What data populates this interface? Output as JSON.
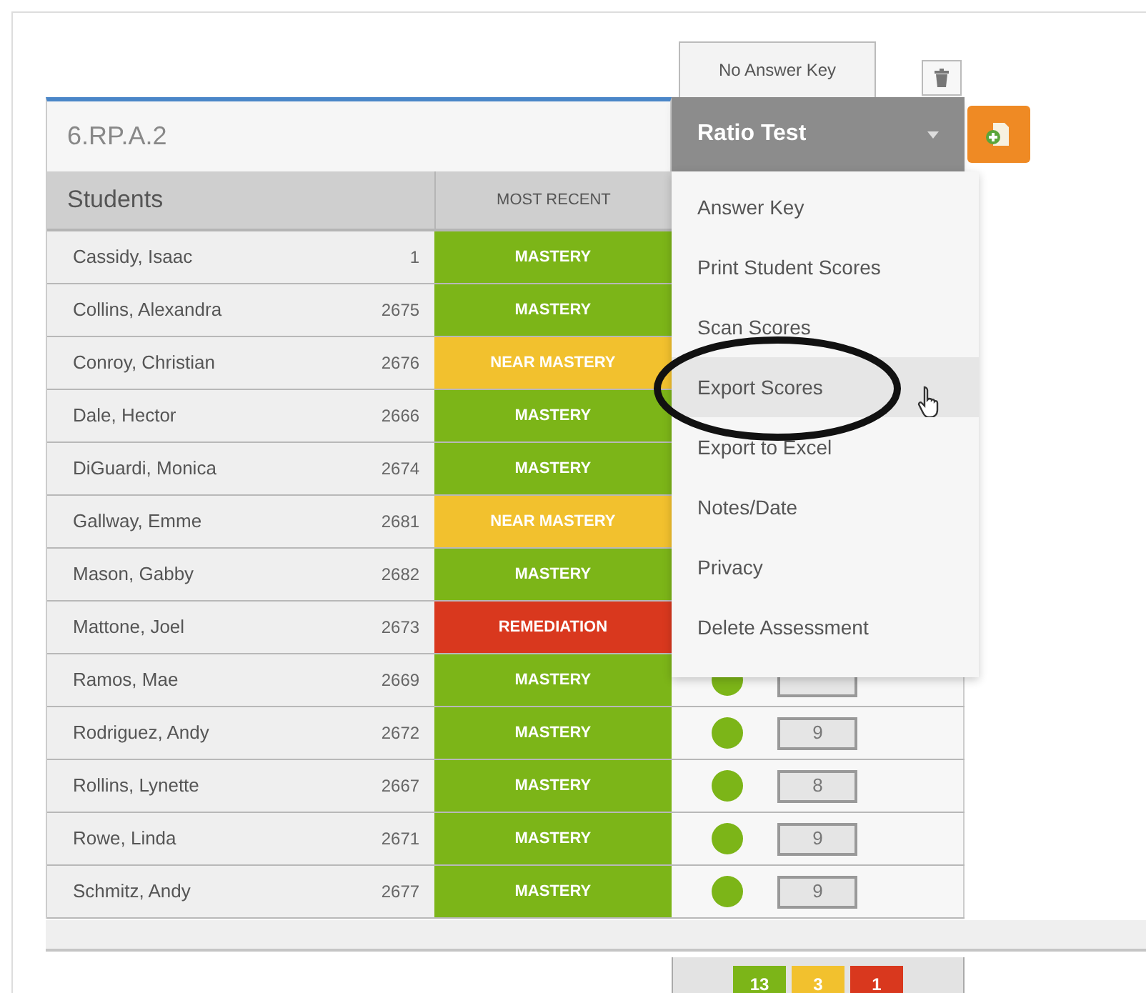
{
  "answer_key_tab": {
    "label": "No Answer Key"
  },
  "standard_field": {
    "value": "6.RP.A.2"
  },
  "assessment_dropdown": {
    "label": "Ratio Test",
    "expanded": true
  },
  "columns": [
    {
      "label": "Students"
    },
    {
      "label": "MOST RECENT"
    }
  ],
  "rows": [
    {
      "name": "Cassidy, Isaac",
      "id": "1",
      "status": {
        "label": "MASTERY",
        "kind": "mastery"
      }
    },
    {
      "name": "Collins, Alexandra",
      "id": "2675",
      "status": {
        "label": "MASTERY",
        "kind": "mastery"
      }
    },
    {
      "name": "Conroy, Christian",
      "id": "2676",
      "status": {
        "label": "NEAR MASTERY",
        "kind": "near"
      }
    },
    {
      "name": "Dale, Hector",
      "id": "2666",
      "status": {
        "label": "MASTERY",
        "kind": "mastery"
      }
    },
    {
      "name": "DiGuardi, Monica",
      "id": "2674",
      "status": {
        "label": "MASTERY",
        "kind": "mastery"
      }
    },
    {
      "name": "Gallway, Emme",
      "id": "2681",
      "status": {
        "label": "NEAR MASTERY",
        "kind": "near"
      }
    },
    {
      "name": "Mason, Gabby",
      "id": "2682",
      "status": {
        "label": "MASTERY",
        "kind": "mastery"
      }
    },
    {
      "name": "Mattone, Joel",
      "id": "2673",
      "status": {
        "label": "REMEDIATION",
        "kind": "remediation"
      }
    },
    {
      "name": "Ramos, Mae",
      "id": "2669",
      "status": {
        "label": "MASTERY",
        "kind": "mastery"
      },
      "color": "#7cb518"
    },
    {
      "name": "Rodriguez, Andy",
      "id": "2672",
      "status": {
        "label": "MASTERY",
        "kind": "mastery"
      },
      "color": "#7cb518",
      "score": "9"
    },
    {
      "name": "Rollins, Lynette",
      "id": "2667",
      "status": {
        "label": "MASTERY",
        "kind": "mastery"
      },
      "color": "#7cb518",
      "score": "8"
    },
    {
      "name": "Rowe, Linda",
      "id": "2671",
      "status": {
        "label": "MASTERY",
        "kind": "mastery"
      },
      "color": "#7cb518",
      "score": "9"
    },
    {
      "name": "Schmitz, Andy",
      "id": "2677",
      "status": {
        "label": "MASTERY",
        "kind": "mastery"
      },
      "color": "#7cb518",
      "score": "9"
    }
  ],
  "menu": {
    "items": [
      {
        "label": "Answer Key",
        "selected": false
      },
      {
        "label": "Print Student Scores",
        "selected": false
      },
      {
        "label": "Scan Scores",
        "selected": false
      },
      {
        "label": "Export Scores",
        "selected": true
      },
      {
        "label": "Export to Excel",
        "selected": false
      },
      {
        "label": "Notes/Date",
        "selected": false
      },
      {
        "label": "Privacy",
        "selected": false
      },
      {
        "label": "Delete Assessment",
        "selected": false
      }
    ]
  },
  "summary": [
    {
      "label": "13",
      "color": "#7cb518"
    },
    {
      "label": "3",
      "color": "#f2c12e"
    },
    {
      "label": "1",
      "color": "#d9381e"
    }
  ]
}
